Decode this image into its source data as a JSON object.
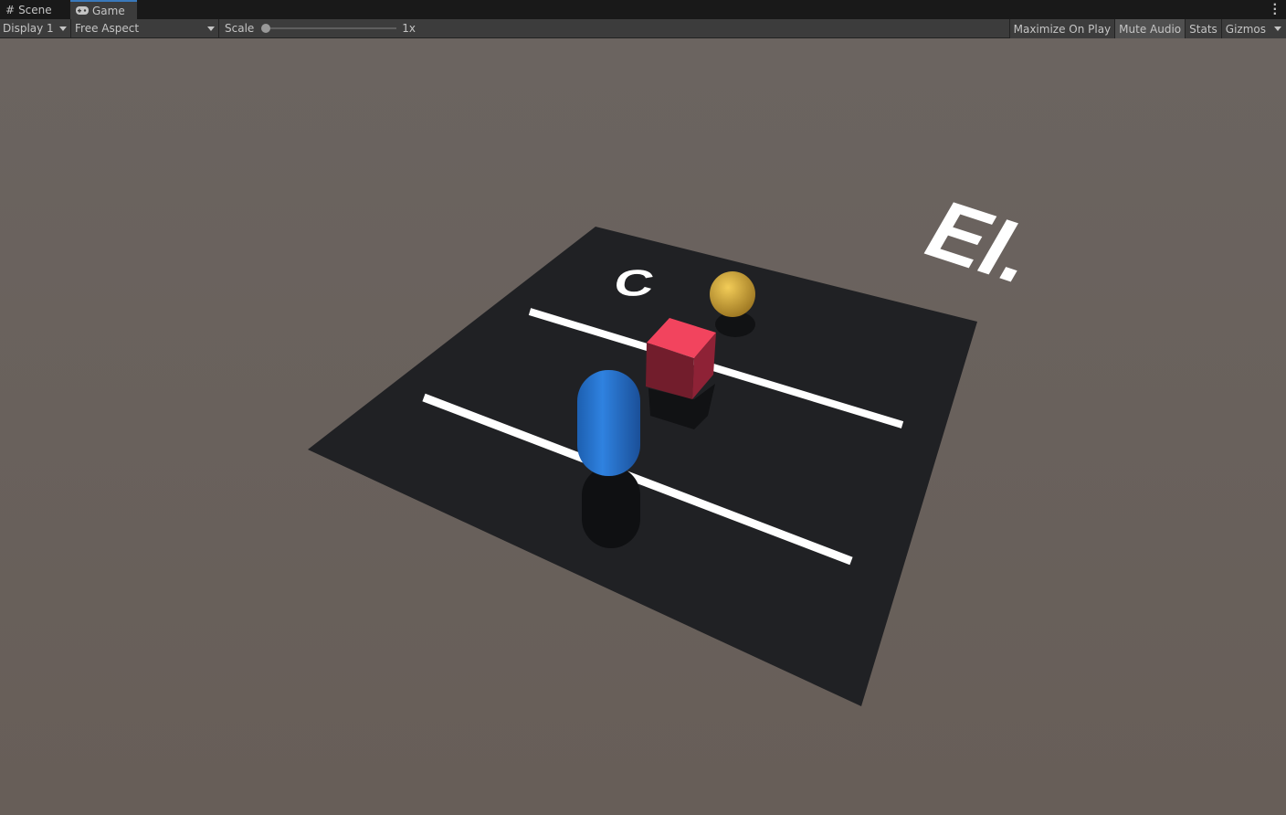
{
  "tabs": [
    {
      "label": "Scene",
      "icon": "grid-icon"
    },
    {
      "label": "Game",
      "icon": "gamepad-icon",
      "active": true
    }
  ],
  "toolbar": {
    "display": "Display 1",
    "aspect": "Free Aspect",
    "scale_label": "Scale",
    "scale_value": "1x",
    "scale_fraction": 0,
    "maximize": "Maximize On Play",
    "mute": "Mute Audio",
    "stats": "Stats",
    "gizmos": "Gizmos",
    "mute_active": true
  },
  "scene": {
    "text_top": "C",
    "text_bottom": "EI.",
    "colors": {
      "ground": "#6a625c",
      "board": "#202124",
      "cube": "#e0334f",
      "sphere": "#e0b43a",
      "capsule": "#2a7ad8",
      "lines": "#ffffff"
    }
  }
}
